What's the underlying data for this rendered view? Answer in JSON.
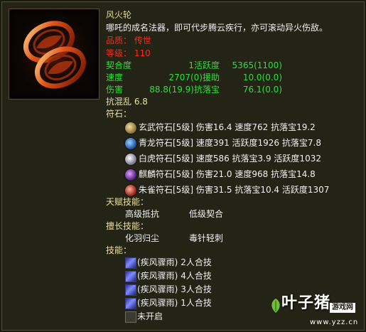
{
  "item": {
    "name": "风火轮",
    "description": "哪吒的成名法器，即可代步腾云疾行，亦可滚动异火伤敌。",
    "quality_label": "品质：",
    "quality_value": "传世",
    "level_label": "等级：",
    "level_value": "110"
  },
  "stats": [
    {
      "row": [
        "契合度",
        "1活跃度",
        "5365(1100)"
      ]
    },
    {
      "row": [
        "速度",
        "2707(0)援助",
        "10.0(0.0)"
      ]
    },
    {
      "row": [
        "伤害",
        "88.8(19.9)抗落宝",
        "76.1(0.0)"
      ]
    }
  ],
  "resist": {
    "label": "抗混乱",
    "value": "6.8"
  },
  "runes": {
    "header": "符石：",
    "items": [
      {
        "text": "玄武符石[5级] 伤害16.4 速度762 抗落宝19.2",
        "color": "#c8b070"
      },
      {
        "text": "青龙符石[5级] 速度391 活跃度1926 抗落宝7.8",
        "color": "#3a8ee8"
      },
      {
        "text": "白虎符石[5级] 速度586 抗落宝3.9 活跃度1032",
        "color": "#d8d8e8"
      },
      {
        "text": "麒麟符石[5级] 伤害21.0 速度968 抗落宝14.8",
        "color": "#8a40c8"
      },
      {
        "text": "朱雀符石[5级] 伤害31.5 抗落宝10.4 活跃度1307",
        "color": "#d84030"
      }
    ]
  },
  "talent": {
    "header": "天赋技能：",
    "skills": [
      "高级抵抗",
      "低级契合"
    ]
  },
  "expertise": {
    "header": "擅长技能：",
    "skills": [
      "化羽归尘",
      "毒针轻刺"
    ]
  },
  "skills": {
    "header": "技能：",
    "items": [
      {
        "name": "(疾风骤雨)",
        "desc": "2人合技",
        "icon": "skill-rain-icon"
      },
      {
        "name": "(疾风骤雨)",
        "desc": "4人合技",
        "icon": "skill-rain-icon"
      },
      {
        "name": "(疾风骤雨)",
        "desc": "3人合技",
        "icon": "skill-rain-icon"
      },
      {
        "name": "(疾风骤雨)",
        "desc": "1人合技",
        "icon": "skill-rain-icon"
      }
    ],
    "locked": "未开启"
  },
  "watermark": {
    "brand": "叶子猪",
    "tag": "游戏网",
    "url": "www.yzz.cn"
  }
}
